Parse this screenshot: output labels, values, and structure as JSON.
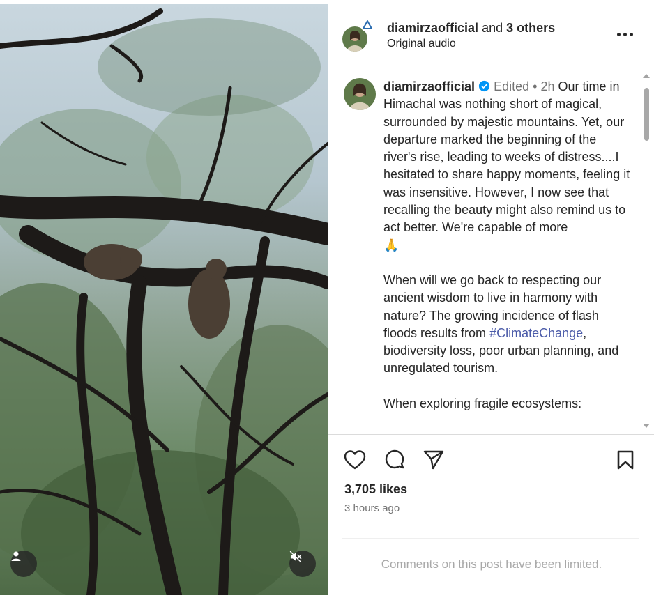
{
  "header": {
    "username": "diamirzaofficial",
    "and_text": "and",
    "others": "3 others",
    "audio": "Original audio"
  },
  "caption": {
    "username": "diamirzaofficial",
    "edited": "Edited",
    "separator": "•",
    "age": "2h",
    "paragraph1": "Our time in Himachal was nothing short of magical, surrounded by majestic mountains. Yet, our departure marked the beginning of the river's rise, leading to weeks of distress....I hesitated to share happy moments, feeling it was insensitive. However, I now see that recalling the beauty might also remind us to act better. We're capable of more",
    "emoji": "🙏",
    "paragraph2_before": "When will we go back to respecting our ancient wisdom to live in harmony with nature? The growing incidence of flash floods results from ",
    "hashtag": "#ClimateChange",
    "paragraph2_after": ", biodiversity loss, poor urban planning, and unregulated tourism.",
    "paragraph3": "When exploring fragile ecosystems:"
  },
  "stats": {
    "likes": "3,705 likes",
    "time": "3 hours ago"
  },
  "footer": {
    "comments_limited": "Comments on this post have been limited."
  },
  "icons": {
    "like": "heart-icon",
    "comment": "comment-bubble-icon",
    "share": "paper-plane-icon",
    "save": "bookmark-icon",
    "more": "more-horizontal-icon",
    "verified": "verified-badge-icon",
    "user_tag": "user-icon",
    "mute": "speaker-muted-icon"
  },
  "colors": {
    "hashtag": "#4a5aa8",
    "verified": "#0095f6",
    "secondary_text": "#737373"
  }
}
